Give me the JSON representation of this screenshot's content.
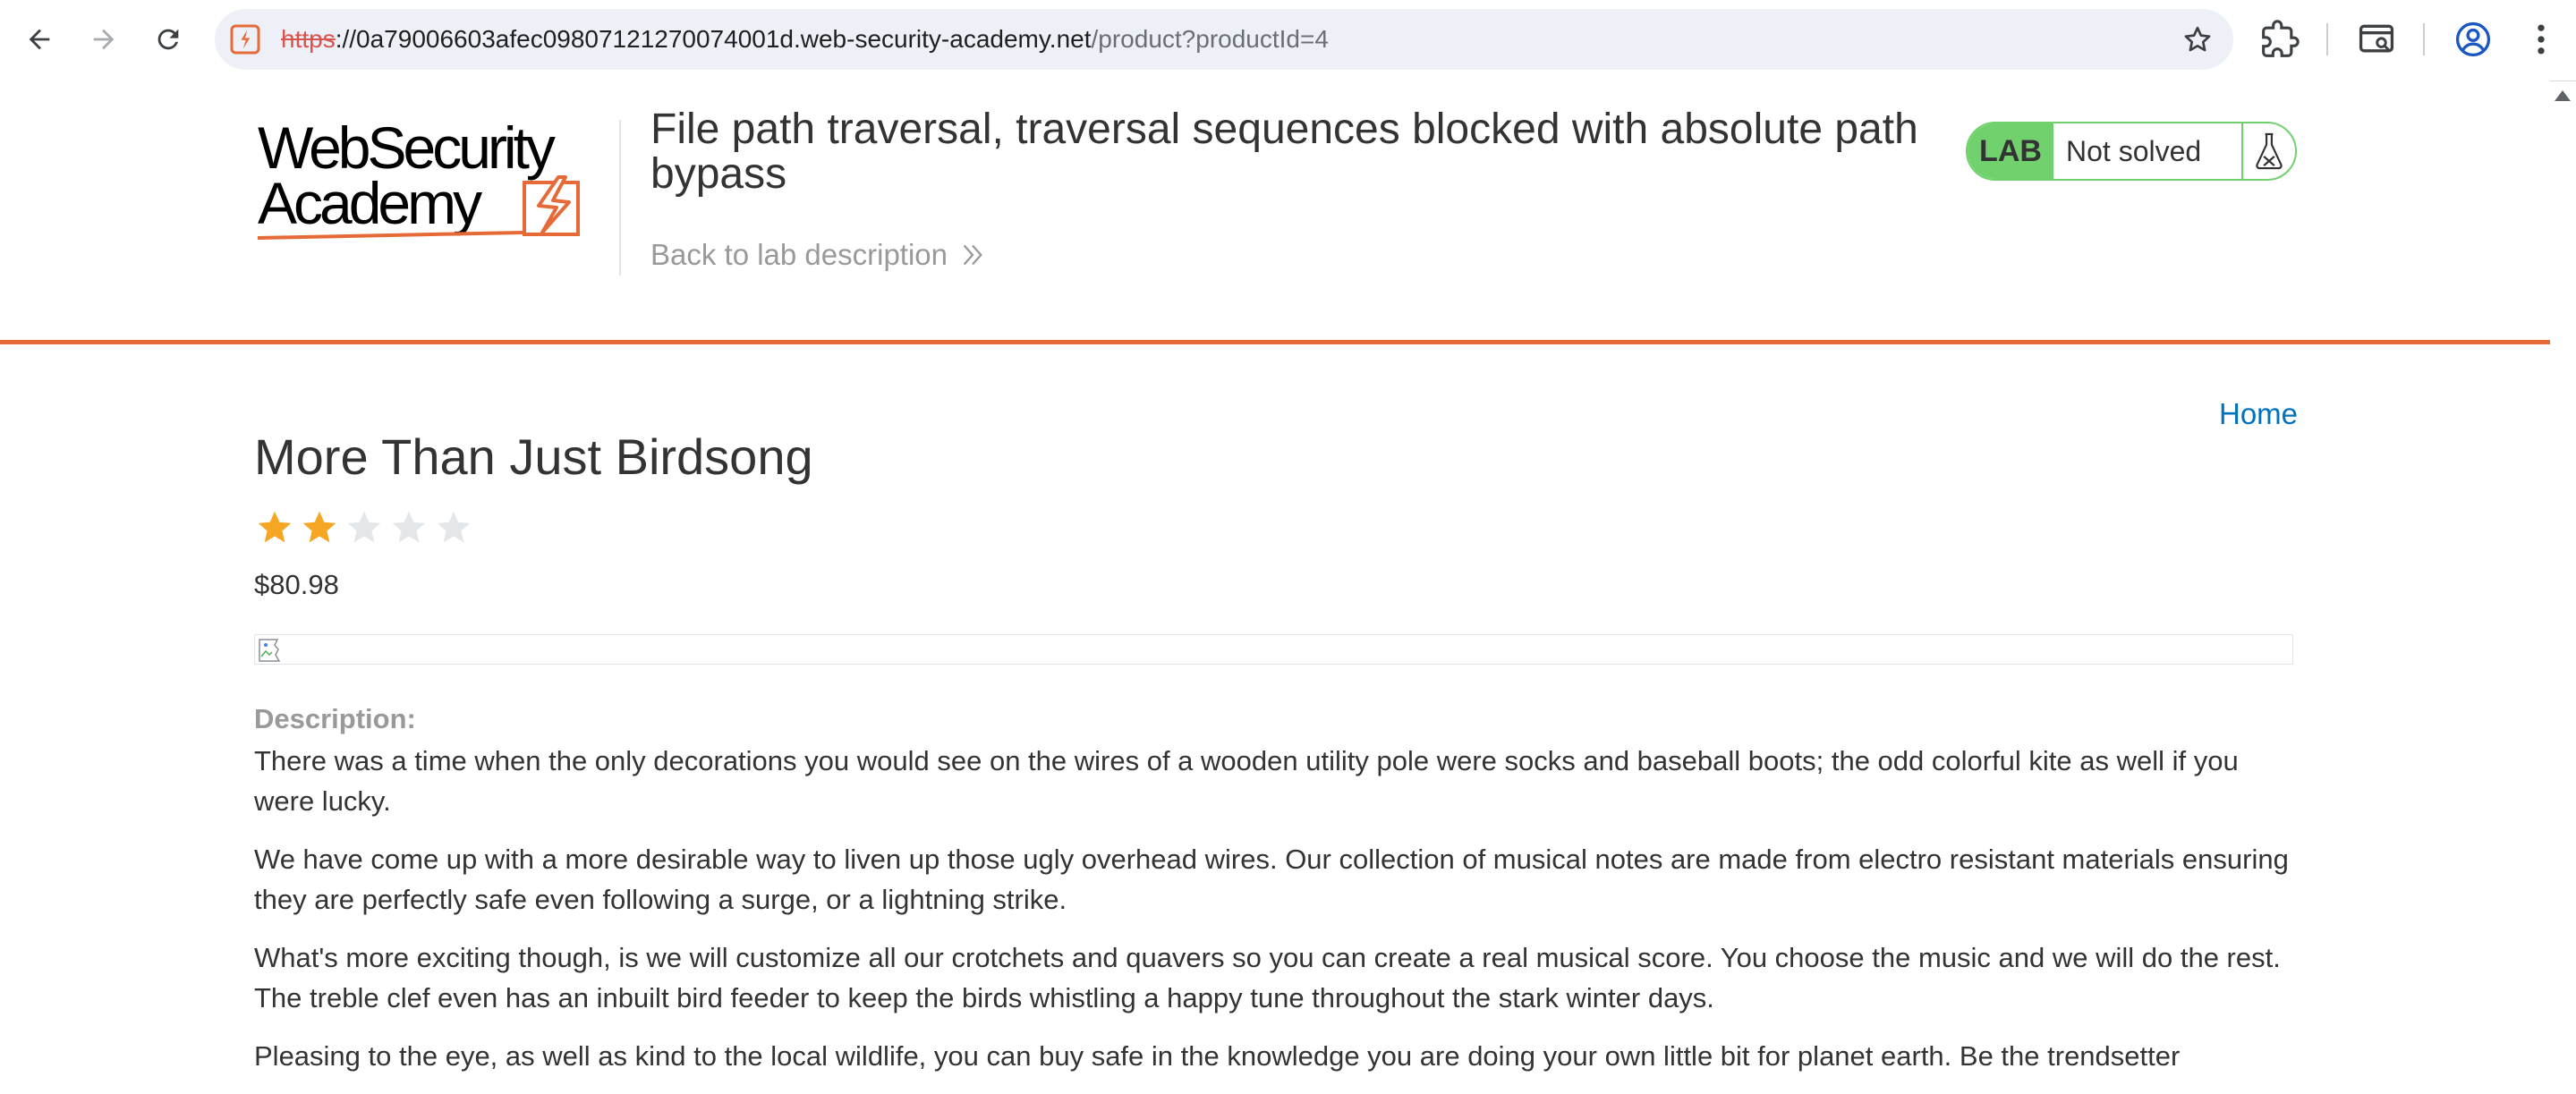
{
  "browser": {
    "url_scheme": "https",
    "url_host": "://0a79006603afec09807121270074001d.web-security-academy.net",
    "url_path": "/product?productId=4",
    "icons": [
      "back-icon",
      "forward-icon",
      "reload-icon",
      "site-info-icon",
      "bookmark-star-icon",
      "extensions-icon",
      "tab-search-icon",
      "profile-icon",
      "menu-icon"
    ]
  },
  "lab": {
    "title": "File path traversal, traversal sequences blocked with absolute path bypass",
    "back_link": "Back to lab description",
    "badge_label": "LAB",
    "status": "Not solved",
    "accent_color": "#e66a37",
    "badge_color": "#70d16d"
  },
  "nav": {
    "home": "Home"
  },
  "product": {
    "name": "More Than Just Birdsong",
    "rating": 2,
    "rating_max": 5,
    "price": "$80.98",
    "description_label": "Description:",
    "description": [
      "There was a time when the only decorations you would see on the wires of a wooden utility pole were socks and baseball boots; the odd colorful kite as well if you were lucky.",
      "We have come up with a more desirable way to liven up those ugly overhead wires. Our collection of musical notes are made from electro resistant materials ensuring they are perfectly safe even following a surge, or a lightning strike.",
      "What's more exciting though, is we will customize all our crotchets and quavers so you can create a real musical score. You choose the music and we will do the rest. The treble clef even has an inbuilt bird feeder to keep the birds whistling a happy tune throughout the stark winter days.",
      "Pleasing to the eye, as well as kind to the local wildlife, you can buy safe in the knowledge you are doing your own little bit for planet earth. Be the trendsetter"
    ]
  }
}
